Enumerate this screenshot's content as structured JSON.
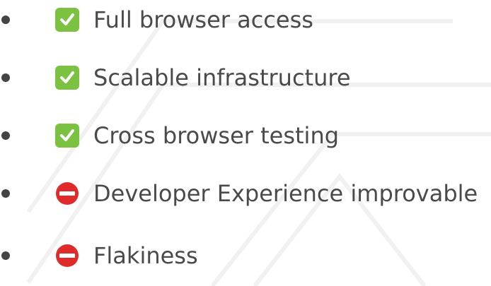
{
  "items": [
    {
      "label": "Full browser access",
      "status": "check-icon"
    },
    {
      "label": "Scalable infrastructure",
      "status": "check-icon"
    },
    {
      "label": "Cross browser testing",
      "status": "check-icon"
    },
    {
      "label": "Developer Experience improvable",
      "status": "no-entry-icon"
    },
    {
      "label": "Flakiness",
      "status": "no-entry-icon"
    }
  ],
  "colors": {
    "text": "#4a4a4a",
    "check": "#7cc241",
    "no_entry": "#e02b2b"
  }
}
